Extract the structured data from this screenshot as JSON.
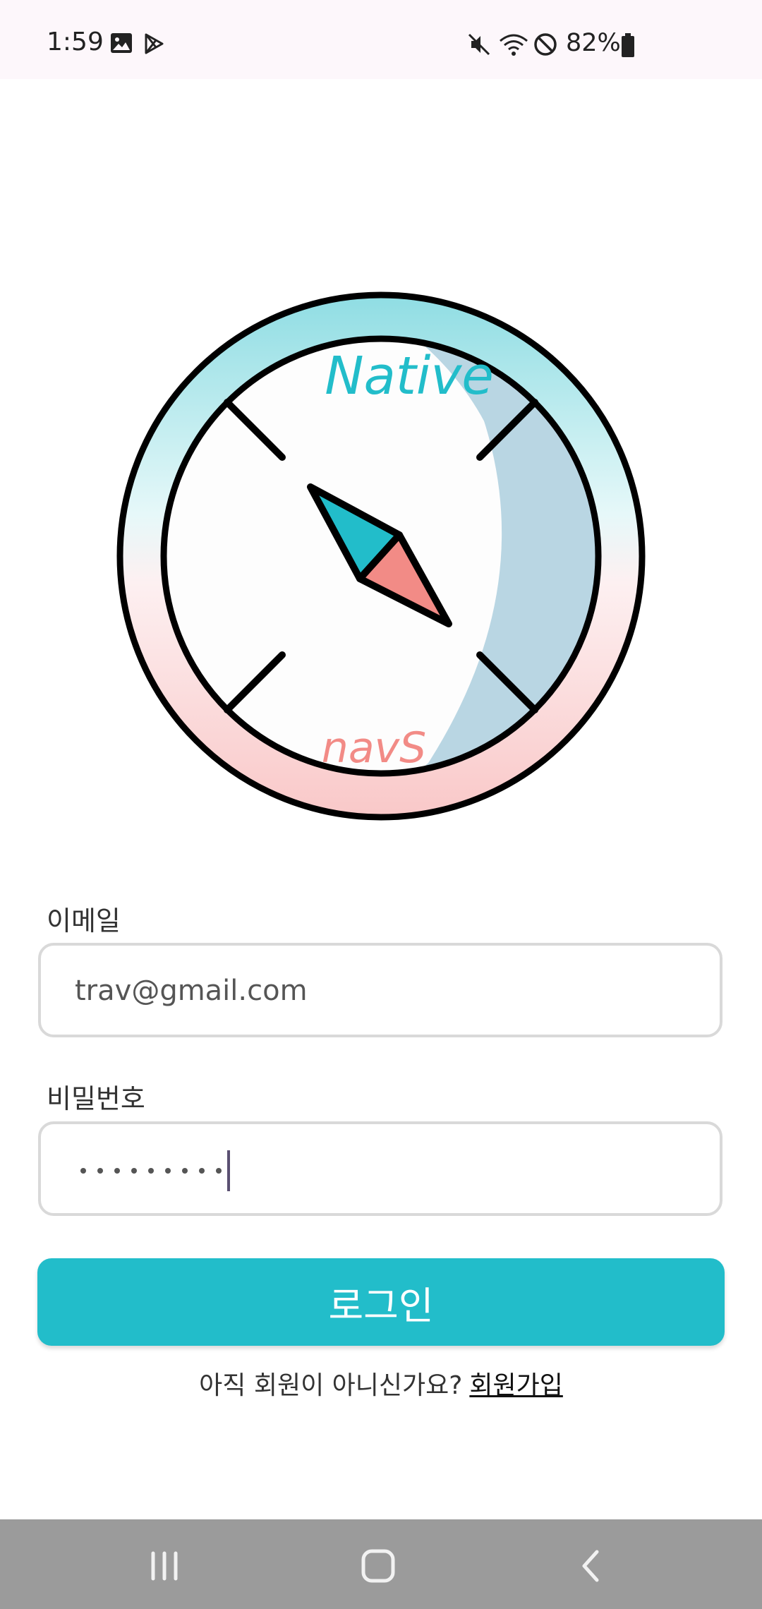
{
  "status_bar": {
    "time": "1:59",
    "battery_percent": "82%",
    "icons": [
      "image-icon",
      "play-store-icon",
      "mute-icon",
      "wifi-icon",
      "do-not-disturb-icon",
      "battery-icon"
    ]
  },
  "logo": {
    "top_text": "Native",
    "bottom_text": "navS",
    "colors": {
      "teal": "#22bdca",
      "pink": "#f28b86",
      "shadow": "#b9d6e3"
    }
  },
  "form": {
    "email_label": "이메일",
    "email_value": "trav@gmail.com",
    "password_label": "비밀번호",
    "password_length": 9
  },
  "login_button": {
    "label": "로그인",
    "color": "#22bdca"
  },
  "signup": {
    "prompt": "아직 회원이 아니신가요?",
    "link": "회원가입"
  },
  "nav_bar": {
    "buttons": [
      "recent-apps-icon",
      "home-icon",
      "back-icon"
    ]
  }
}
